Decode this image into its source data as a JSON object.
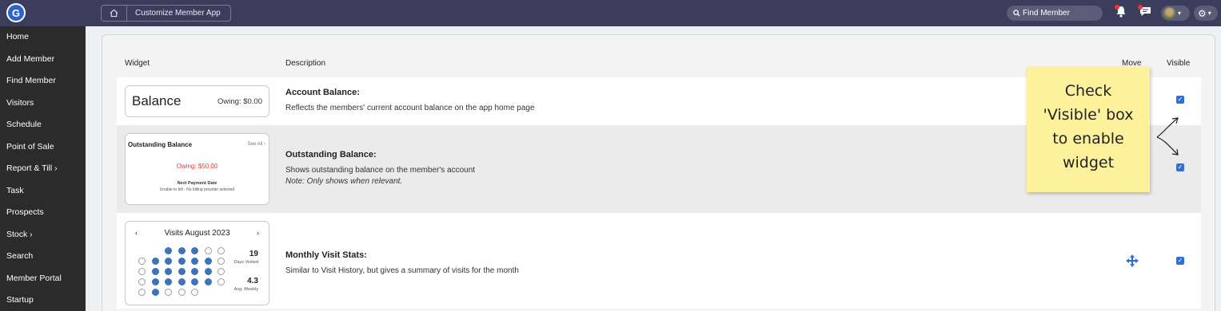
{
  "app": {
    "logo_letter": "G",
    "accent": "#2e6fd6",
    "topbar_color": "#3b3d5c"
  },
  "breadcrumb": {
    "home_icon": "home-icon",
    "label": "Customize Member App"
  },
  "header": {
    "search_placeholder": "Find Member",
    "search_icon": "search-icon",
    "bell_icon": "bell-icon",
    "chat_icon": "chat-icon",
    "avatar_icon": "avatar",
    "gear_icon": "gear-icon"
  },
  "sidebar": {
    "items": [
      {
        "label": "Home"
      },
      {
        "label": "Add Member"
      },
      {
        "label": "Find Member"
      },
      {
        "label": "Visitors"
      },
      {
        "label": "Schedule"
      },
      {
        "label": "Point of Sale"
      },
      {
        "label": "Report & Till ›"
      },
      {
        "label": "Task"
      },
      {
        "label": "Prospects"
      },
      {
        "label": "Stock ›"
      },
      {
        "label": "Search"
      },
      {
        "label": "Member Portal"
      },
      {
        "label": "Startup"
      }
    ]
  },
  "table": {
    "headers": {
      "widget": "Widget",
      "description": "Description",
      "move": "Move",
      "visible": "Visible"
    },
    "rows": [
      {
        "title": "Account Balance:",
        "text": "Reflects the members' current account balance on the app home page",
        "visible": true,
        "widget": {
          "label": "Balance",
          "owing": "Owing: $0.00"
        }
      },
      {
        "title": "Outstanding Balance:",
        "text": "Shows outstanding balance on the member's account",
        "note": "Note: Only shows when relevant.",
        "visible": true,
        "widget": {
          "title": "Outstanding Balance",
          "see_all": "See All ›",
          "owing": "Owing: $50.00",
          "next_label": "Next Payment Date",
          "billing_text": "Unable to bill - No billing provider selected"
        }
      },
      {
        "title": "Monthly Visit Stats:",
        "text": "Similar to Visit History, but gives a summary of visits for the month",
        "visible": true,
        "move_icon": "move-icon",
        "widget": {
          "prev": "‹",
          "month": "Visits August 2023",
          "next": "›",
          "days_visited": "19",
          "days_visited_label": "Days Visited",
          "avg_weekly": "4.3",
          "avg_weekly_label": "Avg. Weekly",
          "calendar": [
            [
              0,
              0,
              1,
              1,
              1,
              0,
              0
            ],
            [
              0,
              1,
              1,
              1,
              1,
              1,
              0
            ],
            [
              0,
              1,
              1,
              1,
              1,
              1,
              0
            ],
            [
              0,
              1,
              1,
              1,
              1,
              1,
              0
            ],
            [
              0,
              1,
              0,
              0,
              0,
              0,
              0
            ]
          ]
        }
      }
    ]
  },
  "annotation": {
    "text": "Check 'Visible' box to enable widget",
    "lines": [
      "Check",
      "'Visible' box",
      "to enable",
      "widget"
    ]
  }
}
